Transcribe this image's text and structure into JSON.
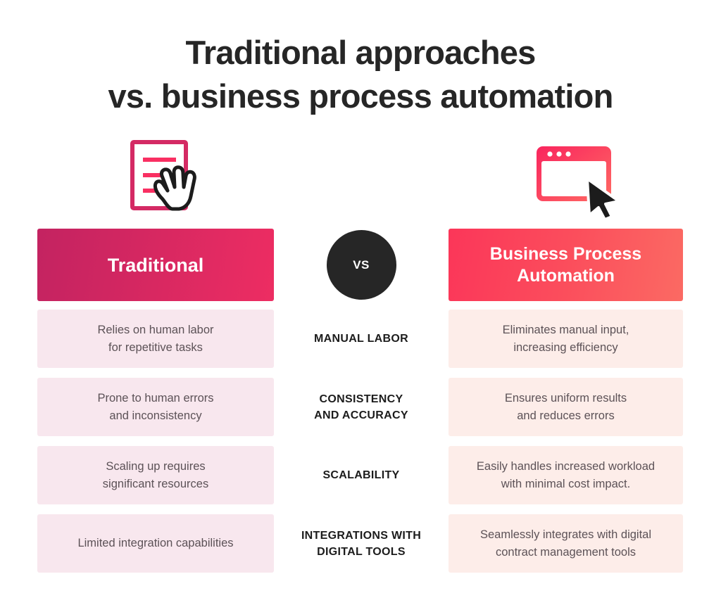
{
  "title": {
    "line1": "Traditional approaches",
    "line2": "vs. business process automation"
  },
  "icons": {
    "left_name": "document-with-hand-cursor-icon",
    "right_name": "browser-window-with-pointer-icon"
  },
  "comparison": {
    "left_header": "Traditional",
    "right_header_line1": "Business Process",
    "right_header_line2": "Automation",
    "vs_label": "VS",
    "rows": [
      {
        "category_line1": "MANUAL LABOR",
        "category_line2": "",
        "left_line1": "Relies on human labor",
        "left_line2": "for repetitive tasks",
        "right_line1": "Eliminates manual input,",
        "right_line2": "increasing efficiency"
      },
      {
        "category_line1": "CONSISTENCY",
        "category_line2": "AND  ACCURACY",
        "left_line1": "Prone to human errors",
        "left_line2": "and inconsistency",
        "right_line1": "Ensures uniform results",
        "right_line2": "and reduces errors"
      },
      {
        "category_line1": "SCALABILITY",
        "category_line2": "",
        "left_line1": "Scaling up requires",
        "left_line2": "significant resources",
        "right_line1": "Easily handles increased workload",
        "right_line2": "with minimal cost impact."
      },
      {
        "category_line1": "INTEGRATIONS WITH",
        "category_line2": "DIGITAL TOOLS",
        "left_line1": "Limited integration capabilities",
        "left_line2": "",
        "right_line1": "Seamlessly integrates with digital",
        "right_line2": "contract management tools"
      }
    ]
  },
  "colors": {
    "traditional_gradient_start": "#c32361",
    "traditional_gradient_end": "#ed2d62",
    "bpa_gradient_start": "#fb3659",
    "bpa_gradient_end": "#fb6a63",
    "left_cell_bg": "#f8e7ee",
    "right_cell_bg": "#fdede9",
    "vs_circle_bg": "#262626",
    "title_text": "#262626",
    "body_text": "#5c5257",
    "icon_pink": "#ef2e63",
    "page_bg": "#ffffff"
  }
}
